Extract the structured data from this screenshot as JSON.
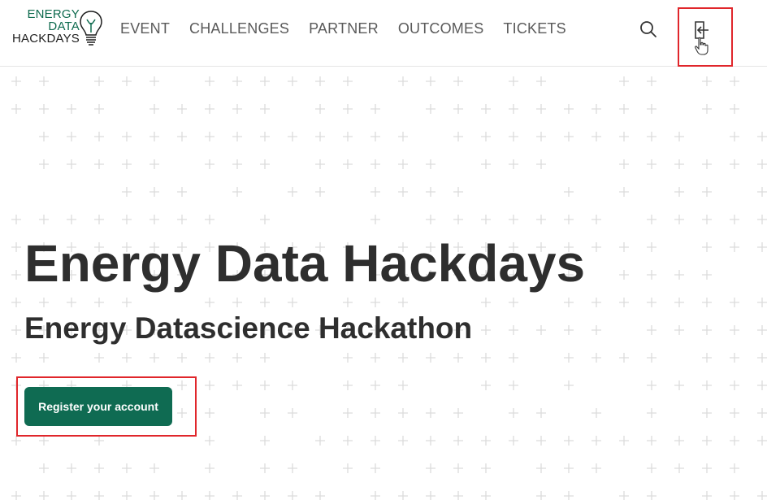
{
  "logo": {
    "line1": "ENERGY",
    "line2": "DATA",
    "line3": "HACKDAYS",
    "icon": "lightbulb-icon"
  },
  "nav": {
    "items": [
      {
        "label": "EVENT"
      },
      {
        "label": "CHALLENGES"
      },
      {
        "label": "PARTNER"
      },
      {
        "label": "OUTCOMES"
      },
      {
        "label": "TICKETS"
      }
    ]
  },
  "header_actions": {
    "search_icon": "search-icon",
    "login_icon": "login-icon"
  },
  "hero": {
    "title": "Energy Data Hackdays",
    "subtitle": "Energy Datascience Hackathon",
    "cta_label": "Register your account"
  },
  "colors": {
    "brand_green": "#0f6b52",
    "text_dark": "#2e2e2e",
    "nav_text": "#5a5a5a",
    "highlight_red": "#e0262b",
    "grid_plus": "#dcdcdc"
  }
}
